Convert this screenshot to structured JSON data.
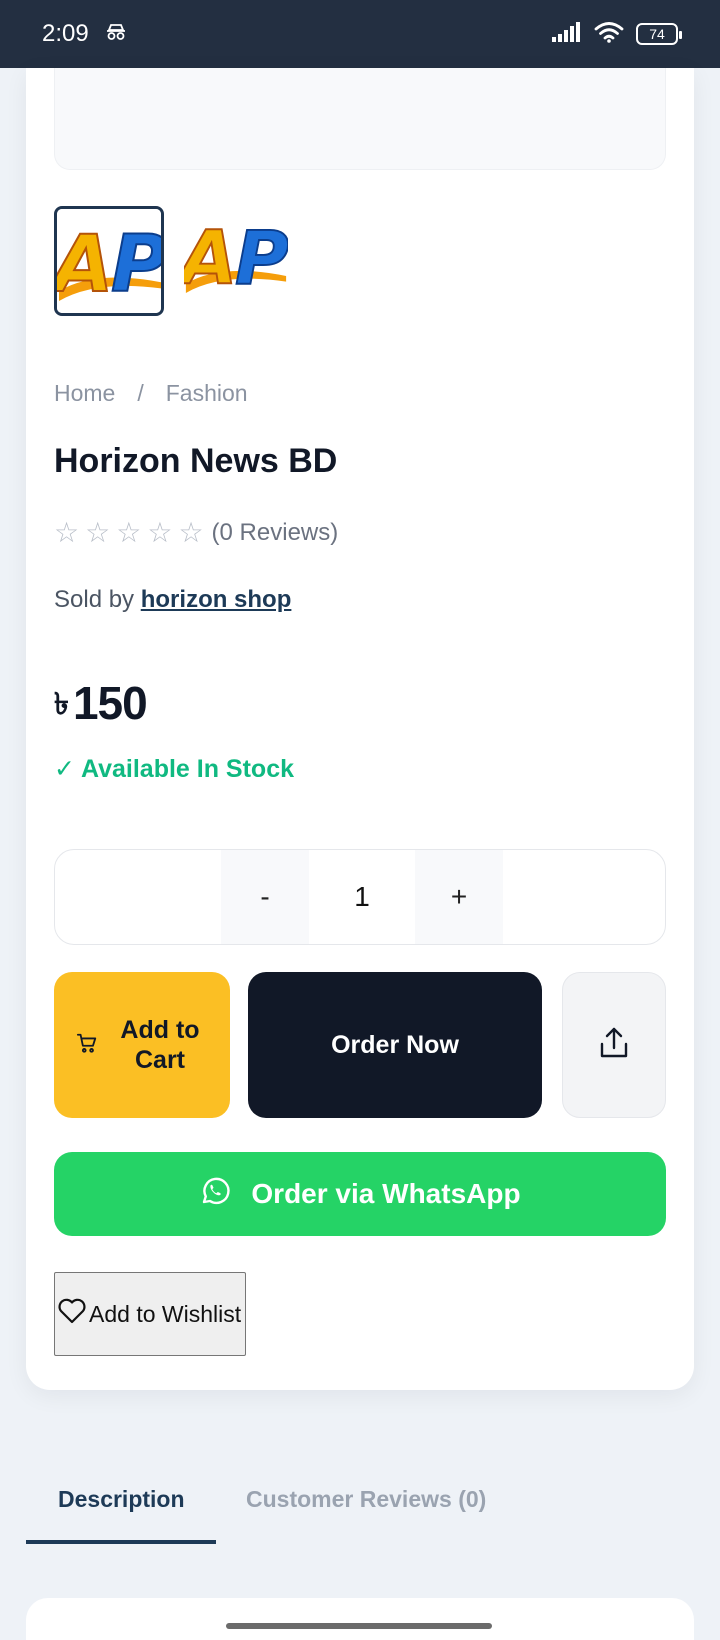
{
  "status_bar": {
    "time": "2:09",
    "battery": "74"
  },
  "breadcrumb": {
    "home": "Home",
    "separator": "/",
    "category": "Fashion"
  },
  "product": {
    "title": "Horizon News BD",
    "reviews_label": "(0 Reviews)",
    "rating": 0,
    "sold_by_prefix": "Sold by",
    "seller": "horizon shop",
    "currency": "৳",
    "price": "150",
    "stock": "✓ Available In Stock"
  },
  "thumbnails": [
    {
      "text": "AP",
      "selected": true
    },
    {
      "text": "AP",
      "selected": false
    }
  ],
  "quantity": {
    "minus": "-",
    "value": "1",
    "plus": "+"
  },
  "actions": {
    "add_to_cart": "Add to Cart",
    "order_now": "Order Now",
    "whatsapp": "Order via WhatsApp",
    "wishlist": "Add to Wishlist"
  },
  "tabs": {
    "description": "Description",
    "reviews": "Customer Reviews (0)"
  },
  "colors": {
    "primary": "#1d3a57",
    "cart": "#fbbf24",
    "order": "#111827",
    "whatsapp": "#25d366",
    "stock": "#10b981"
  },
  "icons": [
    "incognito-icon",
    "signal-icon",
    "wifi-icon",
    "battery-icon",
    "star-icon",
    "cart-icon",
    "share-icon",
    "whatsapp-icon",
    "heart-icon"
  ]
}
